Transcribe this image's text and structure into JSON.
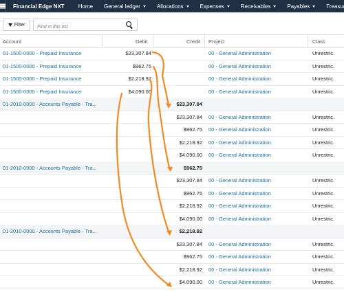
{
  "nav": {
    "brand": "Financial Edge NXT",
    "items": [
      {
        "label": "Home",
        "dropdown": false
      },
      {
        "label": "General ledger",
        "dropdown": true
      },
      {
        "label": "Allocations",
        "dropdown": true
      },
      {
        "label": "Expenses",
        "dropdown": true
      },
      {
        "label": "Receivables",
        "dropdown": true
      },
      {
        "label": "Payables",
        "dropdown": true
      },
      {
        "label": "Treasury",
        "dropdown": false
      }
    ]
  },
  "toolbar": {
    "filter_label": "Filter",
    "search_placeholder": "Find in this list"
  },
  "columns": {
    "account": "Account",
    "debit": "Debit",
    "credit": "Credit",
    "project": "Project",
    "class": "Class"
  },
  "rows": [
    {
      "account": "01-1500-0000 - Prepaid Insurance",
      "debit": "$23,307.84",
      "credit": "",
      "project": "00 - General Administration",
      "class": "Unrestric.",
      "grey": false,
      "bold": false
    },
    {
      "account": "01-1500-0000 - Prepaid Insurance",
      "debit": "$962.75",
      "credit": "",
      "project": "00 - General Administration",
      "class": "Unrestric.",
      "grey": false,
      "bold": false
    },
    {
      "account": "01-1500-0000 - Prepaid Insurance",
      "debit": "$2,218.92",
      "credit": "",
      "project": "00 - General Administration",
      "class": "Unrestric.",
      "grey": false,
      "bold": false
    },
    {
      "account": "01-1500-0000 - Prepaid Insurance",
      "debit": "$4,090.00",
      "credit": "",
      "project": "00 - General Administration",
      "class": "Unrestric.",
      "grey": false,
      "bold": false
    },
    {
      "account": "01-2010-0000 - Accounts Payable - Tra...",
      "debit": "",
      "credit": "$23,307.84",
      "project": "",
      "class": "",
      "grey": true,
      "bold": true
    },
    {
      "account": "",
      "debit": "",
      "credit": "$23,307.84",
      "project": "00 - General Administration",
      "class": "Unrestric.",
      "grey": false,
      "bold": false
    },
    {
      "account": "",
      "debit": "",
      "credit": "$962.75",
      "project": "00 - General Administration",
      "class": "Unrestric.",
      "grey": false,
      "bold": false
    },
    {
      "account": "",
      "debit": "",
      "credit": "$2,218.92",
      "project": "00 - General Administration",
      "class": "Unrestric.",
      "grey": false,
      "bold": false
    },
    {
      "account": "",
      "debit": "",
      "credit": "$4,090.00",
      "project": "00 - General Administration",
      "class": "Unrestric.",
      "grey": false,
      "bold": false
    },
    {
      "account": "01-2010-0000 - Accounts Payable - Tra...",
      "debit": "",
      "credit": "$962.75",
      "project": "",
      "class": "",
      "grey": true,
      "bold": true
    },
    {
      "account": "",
      "debit": "",
      "credit": "$23,307.84",
      "project": "00 - General Administration",
      "class": "Unrestric.",
      "grey": false,
      "bold": false
    },
    {
      "account": "",
      "debit": "",
      "credit": "$962.75",
      "project": "00 - General Administration",
      "class": "Unrestric.",
      "grey": false,
      "bold": false
    },
    {
      "account": "",
      "debit": "",
      "credit": "$2,218.92",
      "project": "00 - General Administration",
      "class": "Unrestric.",
      "grey": false,
      "bold": false
    },
    {
      "account": "",
      "debit": "",
      "credit": "$4,090.00",
      "project": "00 - General Administration",
      "class": "Unrestric.",
      "grey": false,
      "bold": false
    },
    {
      "account": "01-2010-0000 - Accounts Payable - Tra...",
      "debit": "",
      "credit": "$2,218.92",
      "project": "",
      "class": "",
      "grey": true,
      "bold": true
    },
    {
      "account": "",
      "debit": "",
      "credit": "$23,307.84",
      "project": "00 - General Administration",
      "class": "Unrestric.",
      "grey": false,
      "bold": false
    },
    {
      "account": "",
      "debit": "",
      "credit": "$962.75",
      "project": "00 - General Administration",
      "class": "Unrestric.",
      "grey": false,
      "bold": false
    },
    {
      "account": "",
      "debit": "",
      "credit": "$2,218.92",
      "project": "00 - General Administration",
      "class": "Unrestric.",
      "grey": false,
      "bold": false
    },
    {
      "account": "",
      "debit": "",
      "credit": "$4,090.00",
      "project": "00 - General Administration",
      "class": "Unrestric.",
      "grey": false,
      "bold": false
    }
  ],
  "colors": {
    "nav_bg": "#1f2f44",
    "link": "#1a6e9e",
    "annotation": "#f08a24",
    "group_bg": "#f4f5f7"
  }
}
